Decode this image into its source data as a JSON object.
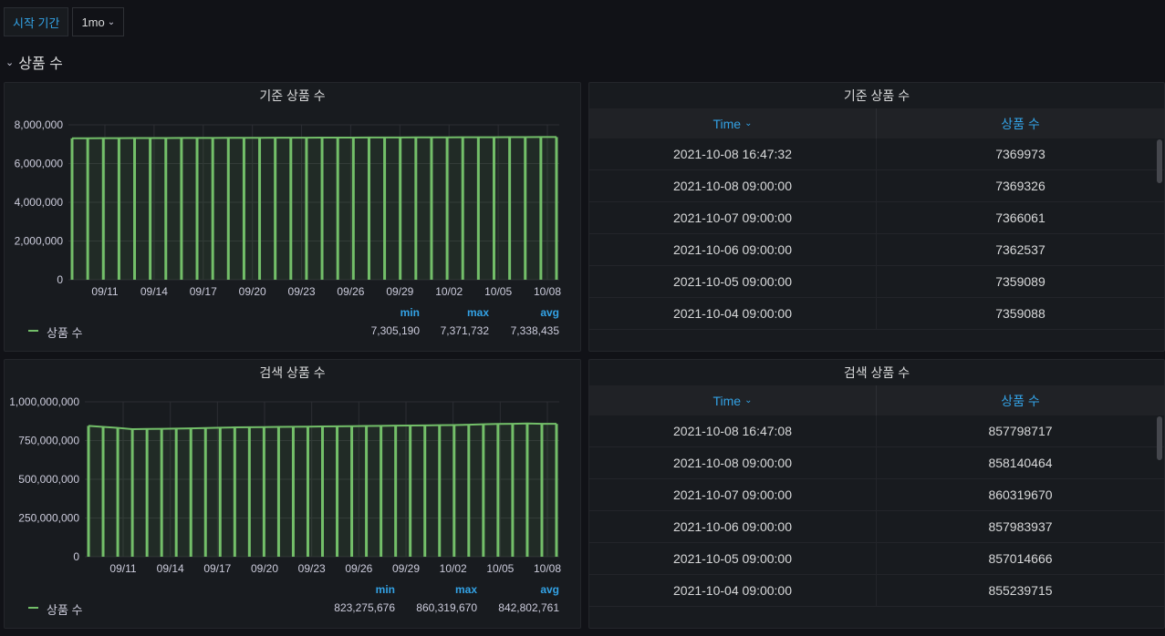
{
  "variables": {
    "label": "시작 기간",
    "value": "1mo"
  },
  "row": {
    "title": "상품 수"
  },
  "colors": {
    "series": "#73bf69",
    "accent": "#33a2e5",
    "background": "#111217",
    "panel": "#181b1f"
  },
  "panels": {
    "base_chart": {
      "title": "기준 상품 수",
      "legend": {
        "series_name": "상품 수",
        "min_label": "min",
        "max_label": "max",
        "avg_label": "avg",
        "min": "7,305,190",
        "max": "7,371,732",
        "avg": "7,338,435"
      }
    },
    "search_chart": {
      "title": "검색 상품 수",
      "legend": {
        "series_name": "상품 수",
        "min_label": "min",
        "max_label": "max",
        "avg_label": "avg",
        "min": "823,275,676",
        "max": "860,319,670",
        "avg": "842,802,761"
      }
    },
    "base_table": {
      "title": "기준 상품 수",
      "col_time": "Time",
      "col_value": "상품 수",
      "rows": [
        [
          "2021-10-08 16:47:32",
          "7369973"
        ],
        [
          "2021-10-08 09:00:00",
          "7369326"
        ],
        [
          "2021-10-07 09:00:00",
          "7366061"
        ],
        [
          "2021-10-06 09:00:00",
          "7362537"
        ],
        [
          "2021-10-05 09:00:00",
          "7359089"
        ],
        [
          "2021-10-04 09:00:00",
          "7359088"
        ]
      ]
    },
    "search_table": {
      "title": "검색 상품 수",
      "col_time": "Time",
      "col_value": "상품 수",
      "rows": [
        [
          "2021-10-08 16:47:08",
          "857798717"
        ],
        [
          "2021-10-08 09:00:00",
          "858140464"
        ],
        [
          "2021-10-07 09:00:00",
          "860319670"
        ],
        [
          "2021-10-06 09:00:00",
          "857983937"
        ],
        [
          "2021-10-05 09:00:00",
          "857014666"
        ],
        [
          "2021-10-04 09:00:00",
          "855239715"
        ]
      ]
    }
  },
  "chart_data": [
    {
      "type": "bar",
      "title": "기준 상품 수",
      "x_ticks": [
        "09/11",
        "09/14",
        "09/17",
        "09/20",
        "09/23",
        "09/26",
        "09/29",
        "10/02",
        "10/05",
        "10/08"
      ],
      "y_ticks": [
        "8,000,000",
        "6,000,000",
        "4,000,000",
        "2,000,000",
        "0"
      ],
      "ylim": [
        0,
        8000000
      ],
      "series": [
        {
          "name": "상품 수",
          "values": [
            7305190,
            7308000,
            7311000,
            7313000,
            7315000,
            7317000,
            7319000,
            7321000,
            7323000,
            7325000,
            7327000,
            7329000,
            7331000,
            7333000,
            7335000,
            7337000,
            7339000,
            7341000,
            7343000,
            7345000,
            7347000,
            7349000,
            7351000,
            7353000,
            7355000,
            7357000,
            7359088,
            7359089,
            7362537,
            7366061,
            7369326,
            7369973
          ]
        }
      ]
    },
    {
      "type": "bar",
      "title": "검색 상품 수",
      "x_ticks": [
        "09/11",
        "09/14",
        "09/17",
        "09/20",
        "09/23",
        "09/26",
        "09/29",
        "10/02",
        "10/05",
        "10/08"
      ],
      "y_ticks": [
        "1,000,000,000",
        "750,000,000",
        "500,000,000",
        "250,000,000",
        "0"
      ],
      "ylim": [
        0,
        1000000000
      ],
      "series": [
        {
          "name": "상품 수",
          "values": [
            845000000,
            838000000,
            832000000,
            823275676,
            825000000,
            826000000,
            827000000,
            829000000,
            831000000,
            833000000,
            835000000,
            836000000,
            837000000,
            838000000,
            839000000,
            840000000,
            841000000,
            842000000,
            843000000,
            844000000,
            845000000,
            846000000,
            847000000,
            848000000,
            849000000,
            850000000,
            852000000,
            855239715,
            857014666,
            857983937,
            860319670,
            858140464,
            857798717
          ]
        }
      ]
    }
  ]
}
